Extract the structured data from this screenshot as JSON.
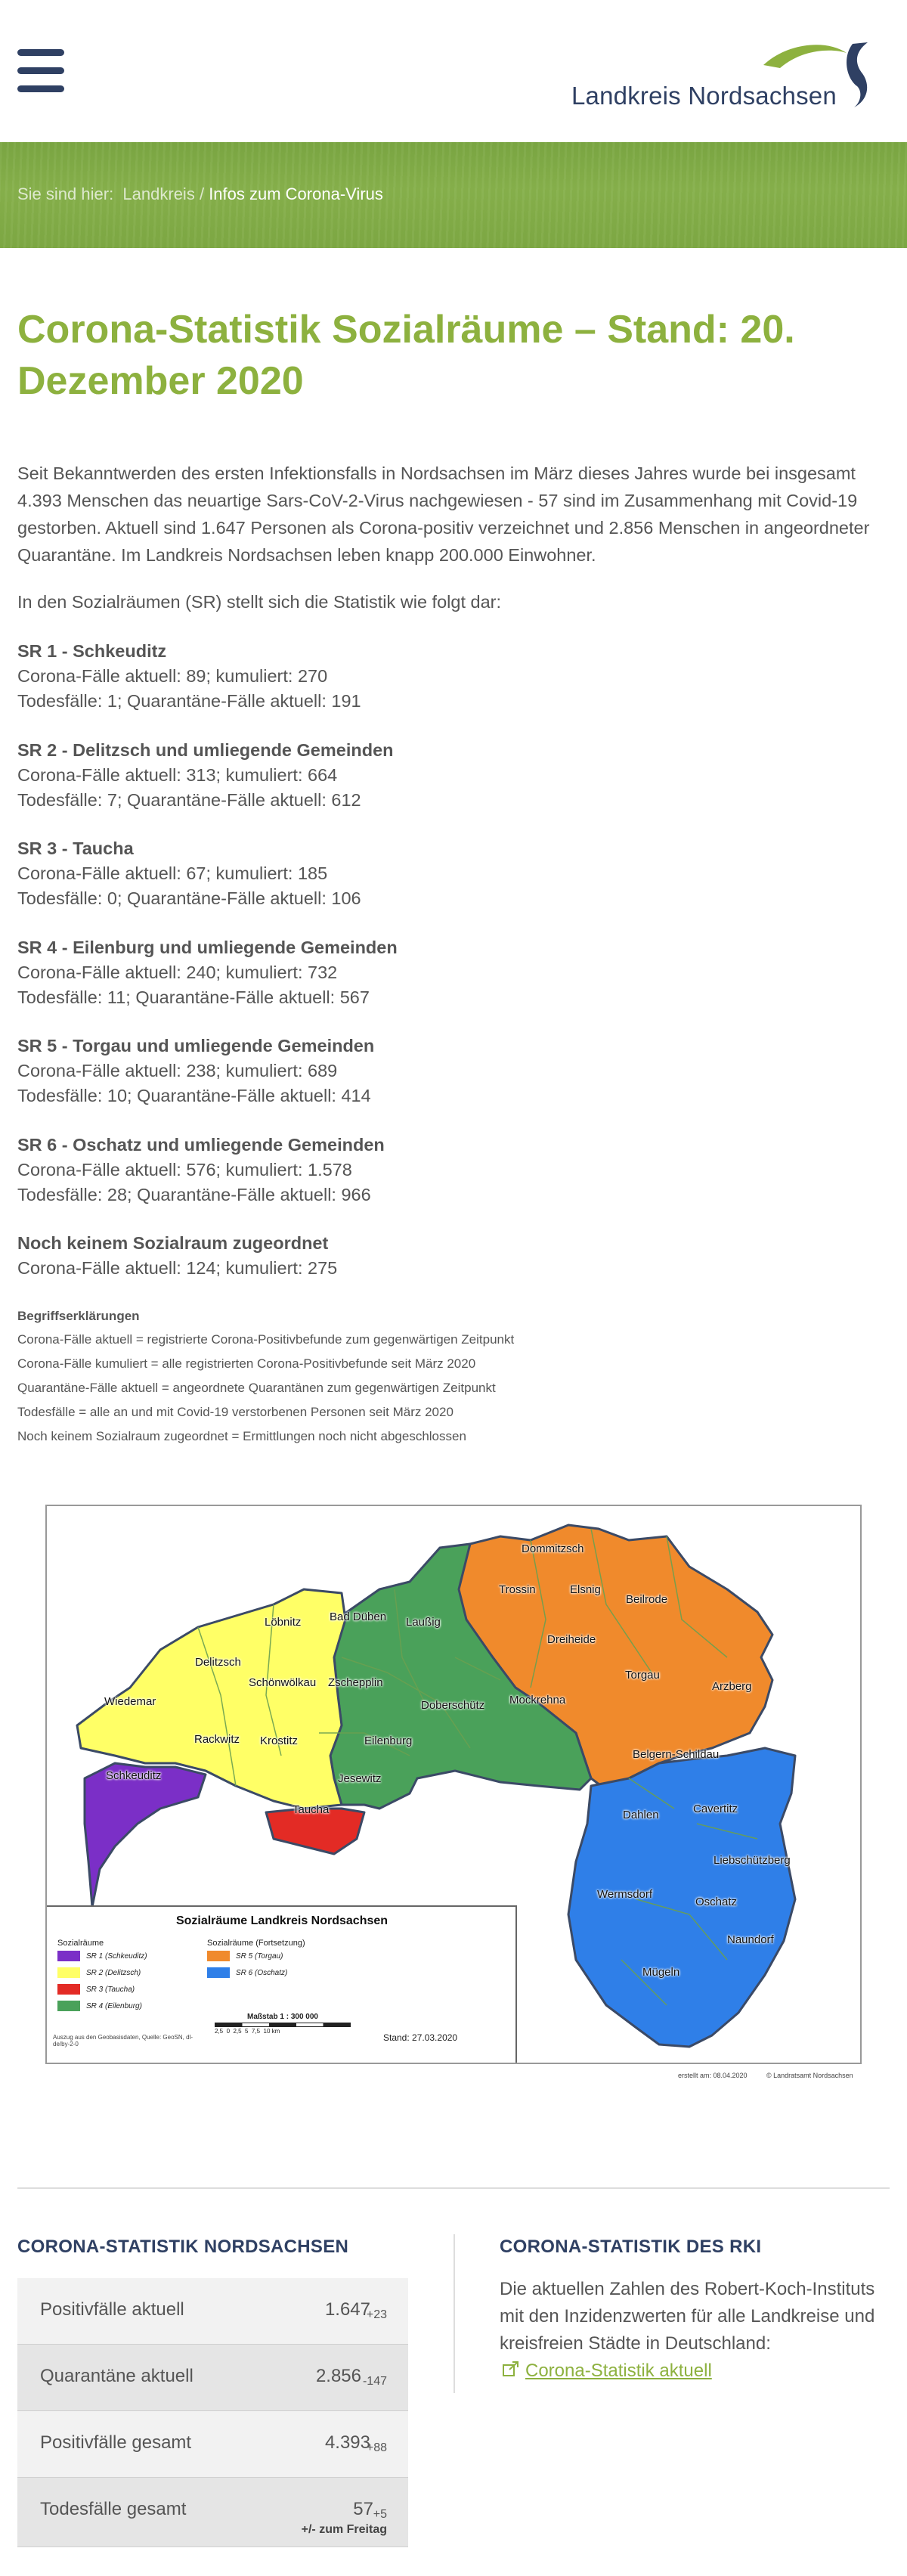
{
  "header": {
    "menu_icon": "hamburger-menu-icon",
    "logo_text": "Landkreis Nordsachsen",
    "logo_color": "#2f4063",
    "accent_color": "#8db13f"
  },
  "breadcrumb": {
    "prefix": "Sie sind hier:",
    "items": [
      "Landkreis",
      "Infos zum Corona-Virus"
    ],
    "separator": "/"
  },
  "article": {
    "title": "Corona-Statistik Sozialräume – Stand: 20. Dezember 2020",
    "intro": "Seit Bekanntwerden des ersten Infektionsfalls in Nordsachsen im März dieses Jahres wurde bei insgesamt 4.393 Menschen das neuartige Sars-CoV-2-Virus nachgewiesen - 57 sind im Zusammenhang mit Covid-19 gestorben. Aktuell sind 1.647 Personen als Corona-positiv verzeichnet und 2.856 Menschen in angeordneter Quarantäne. Im Landkreis Nordsachsen leben knapp 200.000 Einwohner.",
    "lead": "In den Sozialräumen (SR) stellt sich die Statistik wie folgt dar:",
    "regions": [
      {
        "heading": "SR 1 - Schkeuditz",
        "line1": "Corona-Fälle aktuell: 89; kumuliert: 270",
        "line2": "Todesfälle: 1; Quarantäne-Fälle aktuell: 191"
      },
      {
        "heading": "SR 2 - Delitzsch und umliegende Gemeinden",
        "line1": "Corona-Fälle aktuell: 313; kumuliert: 664",
        "line2": "Todesfälle: 7; Quarantäne-Fälle aktuell: 612"
      },
      {
        "heading": "SR 3 - Taucha",
        "line1": "Corona-Fälle aktuell: 67; kumuliert: 185",
        "line2": "Todesfälle: 0; Quarantäne-Fälle aktuell: 106"
      },
      {
        "heading": "SR 4 - Eilenburg und umliegende Gemeinden",
        "line1": "Corona-Fälle aktuell: 240; kumuliert: 732",
        "line2": "Todesfälle: 11; Quarantäne-Fälle aktuell: 567"
      },
      {
        "heading": "SR 5 - Torgau und umliegende Gemeinden",
        "line1": "Corona-Fälle aktuell: 238; kumuliert: 689",
        "line2": "Todesfälle: 10; Quarantäne-Fälle aktuell: 414"
      },
      {
        "heading": "SR 6 - Oschatz und umliegende Gemeinden",
        "line1": "Corona-Fälle aktuell: 576; kumuliert: 1.578",
        "line2": "Todesfälle: 28; Quarantäne-Fälle aktuell: 966"
      },
      {
        "heading": "Noch keinem Sozialraum zugeordnet",
        "line1": "Corona-Fälle aktuell: 124; kumuliert: 275",
        "line2": ""
      }
    ],
    "definitions": {
      "heading": "Begriffserklärungen",
      "items": [
        "Corona-Fälle aktuell = registrierte Corona-Positivbefunde zum gegenwärtigen Zeitpunkt",
        "Corona-Fälle kumuliert = alle registrierten Corona-Positivbefunde seit März 2020",
        "Quarantäne-Fälle aktuell = angeordnete Quarantänen zum gegenwärtigen Zeitpunkt",
        "Todesfälle = alle an und mit Covid-19 verstorbenen Personen seit März 2020",
        "Noch keinem Sozialraum zugeordnet = Ermittlungen noch nicht abgeschlossen"
      ]
    }
  },
  "map": {
    "title": "Sozialräume Landkreis Nordsachsen",
    "legend_col1_title": "Sozialräume",
    "legend_col2_title": "Sozialräume (Fortsetzung)",
    "legend": [
      {
        "label": "SR 1 (Schkeuditz)",
        "color": "#7b2fc7"
      },
      {
        "label": "SR 2 (Delitzsch)",
        "color": "#ffff66"
      },
      {
        "label": "SR 3 (Taucha)",
        "color": "#e32b25"
      },
      {
        "label": "SR 4 (Eilenburg)",
        "color": "#4aa15a"
      },
      {
        "label": "SR 5 (Torgau)",
        "color": "#f08a2c"
      },
      {
        "label": "SR 6 (Oschatz)",
        "color": "#2f7fe8"
      }
    ],
    "scale_label": "Maßstab 1 : 300 000",
    "scale_ticks": "2,5  0  2,5  5  7,5  10 km",
    "source": "Auszug aus den Geobasisdaten, Quelle: GeoSN, dl-de/by-2-0",
    "stand": "Stand: 27.03.2020",
    "created": "erstellt am: 08.04.2020",
    "copyright": "© Landratsamt Nordsachsen",
    "places": {
      "dommitzsch": "Dommitzsch",
      "trossin": "Trossin",
      "elsnig": "Elsnig",
      "beilrode": "Beilrode",
      "loebnitz": "Löbnitz",
      "bad_dueben": "Bad Düben",
      "laussig": "Laußig",
      "dreiheide": "Dreiheide",
      "delitzsch": "Delitzsch",
      "schoenwoelkau": "Schönwölkau",
      "zschepplin": "Zschepplin",
      "torgau": "Torgau",
      "arzberg": "Arzberg",
      "wiedemar": "Wiedemar",
      "doberschuetz": "Doberschütz",
      "mockrehna": "Mockrehna",
      "rackwitz": "Rackwitz",
      "krostitz": "Krostitz",
      "eilenburg": "Eilenburg",
      "belgern": "Belgern-Schildau",
      "schkeuditz": "Schkeuditz",
      "jesewitz": "Jesewitz",
      "taucha": "Taucha",
      "dahlen": "Dahlen",
      "cavertitz": "Cavertitz",
      "liebschuetzberg": "Liebschützberg",
      "wermsdorf": "Wermsdorf",
      "oschatz": "Oschatz",
      "naundorf": "Naundorf",
      "mugeln": "Mügeln"
    }
  },
  "stats_nordsachsen": {
    "heading": "CORONA-STATISTIK NORDSACHSEN",
    "rows": [
      {
        "label": "Positivfälle aktuell",
        "value": "1.647",
        "delta": "+23"
      },
      {
        "label": "Quarantäne aktuell",
        "value": "2.856",
        "delta": "-147"
      },
      {
        "label": "Positivfälle gesamt",
        "value": "4.393",
        "delta": "+88"
      },
      {
        "label": "Todesfälle gesamt",
        "value": "57",
        "delta": "+5",
        "note": "+/- zum Freitag"
      }
    ]
  },
  "rki": {
    "heading": "CORONA-STATISTIK DES RKI",
    "text": "Die aktuellen Zahlen des Robert-Koch-Instituts mit den Inzidenzwerten für alle Landkreise und kreisfreien Städte in Deutschland:",
    "link_icon": "external-link-icon",
    "link_label": "Corona-Statistik aktuell"
  }
}
